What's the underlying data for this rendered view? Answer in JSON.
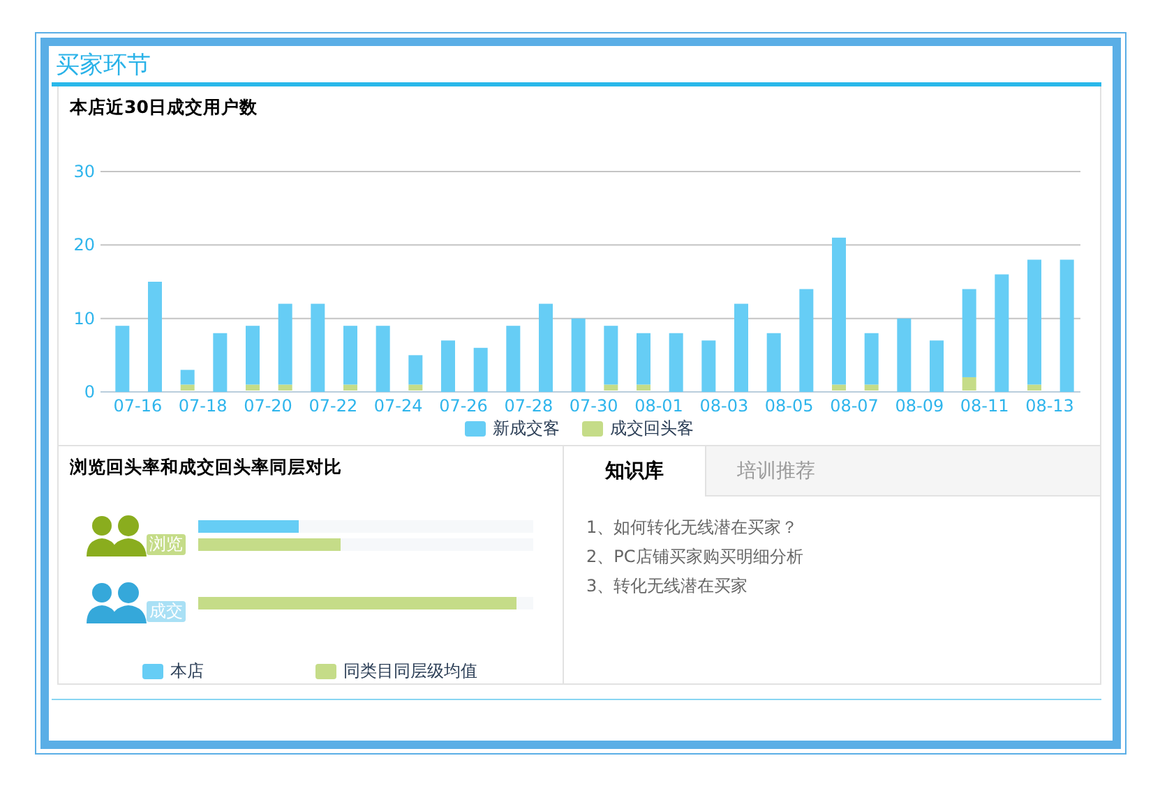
{
  "section_title": "买家环节",
  "users_chart": {
    "title": "本店近30日成交用户数",
    "chart_data": {
      "type": "bar",
      "stacked": true,
      "categories": [
        "07-16",
        null,
        "07-18",
        null,
        "07-20",
        null,
        "07-22",
        null,
        "07-24",
        null,
        "07-26",
        null,
        "07-28",
        null,
        "07-30",
        null,
        "08-01",
        null,
        "08-03",
        null,
        "08-05",
        null,
        "08-07",
        null,
        "08-09",
        null,
        "08-11",
        null,
        "08-13",
        null
      ],
      "series": [
        {
          "name": "成交回头客",
          "color": "#c5dc88",
          "values": [
            0,
            0,
            1,
            0,
            1,
            1,
            0,
            1,
            0,
            1,
            0,
            0,
            0,
            0,
            0,
            1,
            1,
            0,
            0,
            0,
            0,
            0,
            1,
            1,
            0,
            0,
            2,
            0,
            1,
            0
          ]
        },
        {
          "name": "新成交客",
          "color": "#66cdf5",
          "values": [
            9,
            15,
            2,
            8,
            8,
            11,
            12,
            8,
            9,
            4,
            7,
            6,
            9,
            12,
            10,
            8,
            7,
            8,
            7,
            12,
            8,
            14,
            20,
            7,
            10,
            7,
            12,
            16,
            17,
            18
          ]
        }
      ],
      "ylim": [
        0,
        30
      ],
      "yticks": [
        0,
        10,
        20,
        30
      ]
    }
  },
  "comparison": {
    "title": "浏览回头率和成交回头率同层对比",
    "rows": [
      {
        "label": "浏览",
        "kind": "browse",
        "shop": {
          "level": 0.3
        },
        "peer": {
          "level": 0.425
        }
      },
      {
        "label": "成交",
        "kind": "deal",
        "peer": {
          "level": 0.95
        }
      }
    ],
    "legend": [
      {
        "label": "本店",
        "color": "#66cdf5"
      },
      {
        "label": "同类目同层级均值",
        "color": "#c5dc88"
      }
    ]
  },
  "tabs": [
    {
      "label": "知识库",
      "selected": true
    },
    {
      "label": "培训推荐",
      "selected": false
    }
  ],
  "articles": [
    "1、如何转化无线潜在买家？",
    "2、PC店铺买家购买明细分析",
    "3、转化无线潜在买家"
  ]
}
